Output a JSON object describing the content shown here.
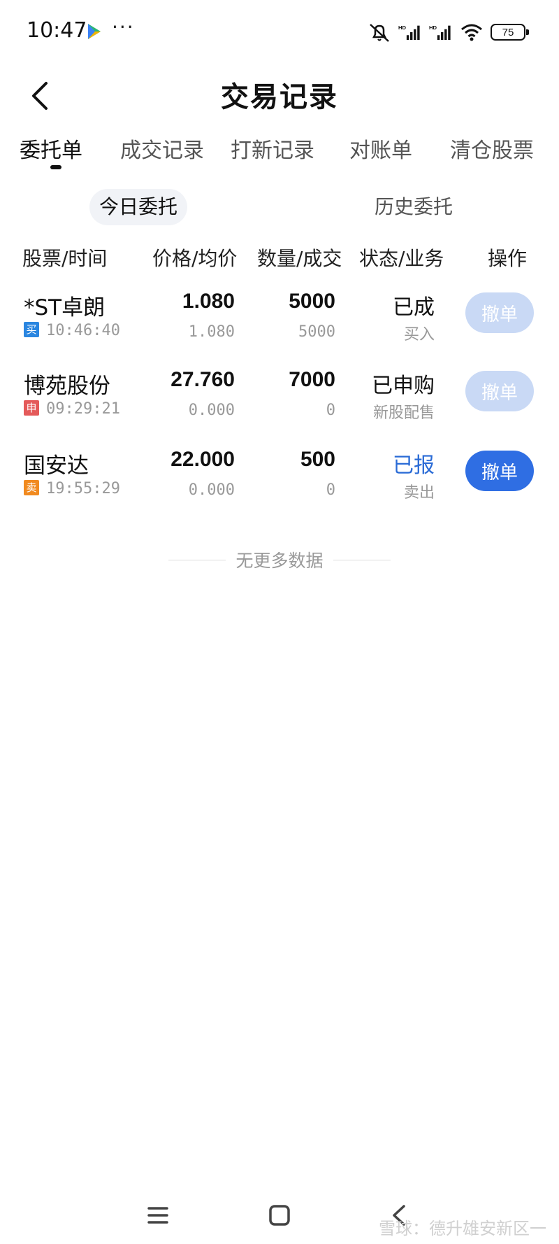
{
  "status_bar": {
    "time": "10:47",
    "more": "···",
    "battery": "75"
  },
  "header": {
    "title": "交易记录"
  },
  "tabs": [
    {
      "label": "委托单",
      "active": true
    },
    {
      "label": "成交记录",
      "active": false
    },
    {
      "label": "打新记录",
      "active": false
    },
    {
      "label": "对账单",
      "active": false
    },
    {
      "label": "清仓股票",
      "active": false
    }
  ],
  "subtabs": [
    {
      "label": "今日委托",
      "active": true
    },
    {
      "label": "历史委托",
      "active": false
    }
  ],
  "columns": {
    "stock_time": "股票/时间",
    "price": "价格/均价",
    "quantity": "数量/成交",
    "status": "状态/业务",
    "action": "操作"
  },
  "orders": [
    {
      "name": "*ST卓朗",
      "tag": "买",
      "time": "10:46:40",
      "price": "1.080",
      "avg_price": "1.080",
      "quantity": "5000",
      "filled": "5000",
      "status": "已成",
      "business": "买入",
      "action": "撤单",
      "action_enabled": false
    },
    {
      "name": "博苑股份",
      "tag": "申",
      "time": "09:29:21",
      "price": "27.760",
      "avg_price": "0.000",
      "quantity": "7000",
      "filled": "0",
      "status": "已申购",
      "business": "新股配售",
      "action": "撤单",
      "action_enabled": false
    },
    {
      "name": "国安达",
      "tag": "卖",
      "time": "19:55:29",
      "price": "22.000",
      "avg_price": "0.000",
      "quantity": "500",
      "filled": "0",
      "status": "已报",
      "business": "卖出",
      "action": "撤单",
      "action_enabled": true
    }
  ],
  "empty_footer": "无更多数据",
  "watermark": "雪球：德升雄安新区一",
  "colors": {
    "accent": "#2f6ee3",
    "disabled_button": "#c9d9f5",
    "reported_status": "#2a6bd6",
    "tag_buy": "#2a86e0",
    "tag_apply": "#e45a5a",
    "tag_sell": "#f18a1f"
  },
  "icons": {
    "back": "chevron-left-icon",
    "nav_menu": "menu-icon",
    "nav_home": "home-square-icon",
    "nav_back": "back-arrow-icon"
  }
}
